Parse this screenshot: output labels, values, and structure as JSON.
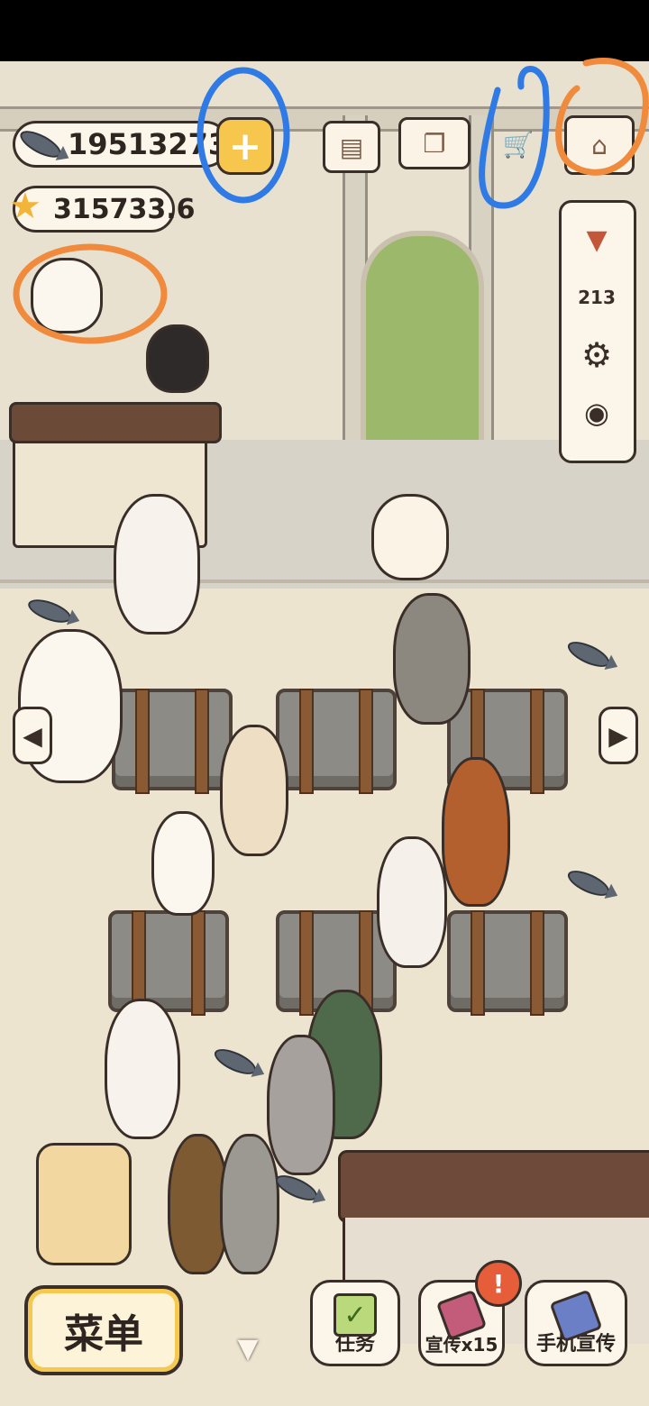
{
  "hud": {
    "fish_currency": "19513273",
    "star_currency": "315733.6",
    "add_currency_symbol": "+",
    "icons": [
      "menu-board-icon",
      "recipe-book-icon",
      "cart-add-icon",
      "shop-icon"
    ]
  },
  "side_panel": {
    "items": [
      "collapse-icon",
      "ranking-podium-icon",
      "settings-gear-icon",
      "camera-icon"
    ],
    "podium_text": "213"
  },
  "navigation": {
    "left_arrow": "◀",
    "right_arrow": "▶",
    "down_arrow": "▼"
  },
  "bottom_bar": {
    "menu_label": "菜单",
    "tasks_label": "任务",
    "promote_label": "宣传x15",
    "phone_promote_label": "手机宣传",
    "alert_symbol": "!"
  },
  "colors": {
    "accent_yellow": "#f6c74c",
    "alert_red": "#e65d3a",
    "outline": "#3a2e28",
    "panel": "#fbf5ea",
    "annotation_blue": "#2f7ae5",
    "annotation_orange": "#f08a3c"
  }
}
